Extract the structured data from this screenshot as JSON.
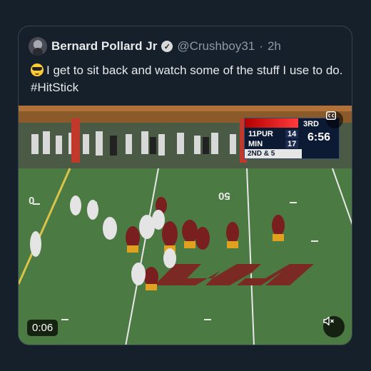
{
  "quote_tweet": {
    "author_name": "Bernard Pollard Jr",
    "verified_mark": "✓",
    "handle": "@Crushboy31",
    "separator": "·",
    "time": "2h",
    "emoji": "smiling-face-with-sunglasses",
    "text": "I get to sit back and watch some of the stuff I use to do. #HitStick"
  },
  "video": {
    "duration": "0:06",
    "cc_icon": "closed-captions-icon",
    "mute_icon": "speaker-muted-icon",
    "scorebug": {
      "quarter": "3RD",
      "team1": "11PUR",
      "score1": "14",
      "team2": "MIN",
      "score2": "17",
      "clock": "6:56",
      "down": "2ND & 5"
    },
    "field_numbers": [
      "0",
      "50"
    ]
  },
  "colors": {
    "background": "#15202b",
    "border": "#38444d",
    "secondary_text": "#8b98a5",
    "link": "#1d9bf0"
  }
}
